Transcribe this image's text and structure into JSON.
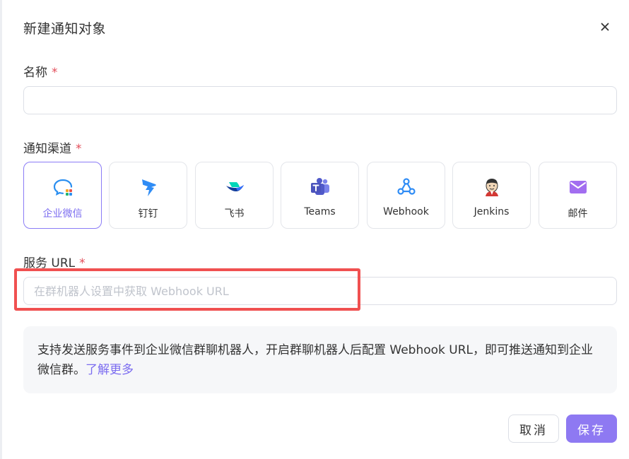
{
  "dialog": {
    "title": "新建通知对象",
    "close_icon": "close-icon"
  },
  "form": {
    "name": {
      "label": "名称",
      "required": "*",
      "value": "",
      "placeholder": ""
    },
    "channel": {
      "label": "通知渠道",
      "required": "*",
      "selected": "企业微信",
      "options": [
        {
          "label": "企业微信",
          "icon": "wecom-icon"
        },
        {
          "label": "钉钉",
          "icon": "dingtalk-icon"
        },
        {
          "label": "飞书",
          "icon": "feishu-icon"
        },
        {
          "label": "Teams",
          "icon": "teams-icon"
        },
        {
          "label": "Webhook",
          "icon": "webhook-icon"
        },
        {
          "label": "Jenkins",
          "icon": "jenkins-icon"
        },
        {
          "label": "邮件",
          "icon": "mail-icon"
        }
      ]
    },
    "service_url": {
      "label": "服务 URL",
      "required": "*",
      "value": "",
      "placeholder": "在群机器人设置中获取 Webhook URL"
    }
  },
  "info": {
    "text": "支持发送服务事件到企业微信群聊机器人，开启群聊机器人后配置 Webhook URL，即可推送通知到企业微信群。",
    "link": "了解更多"
  },
  "buttons": {
    "cancel": "取消",
    "save": "保存"
  },
  "colors": {
    "accent": "#8e79f2",
    "selected_border": "#8b7cf6",
    "required": "#e34d59",
    "highlight": "#f05050"
  }
}
